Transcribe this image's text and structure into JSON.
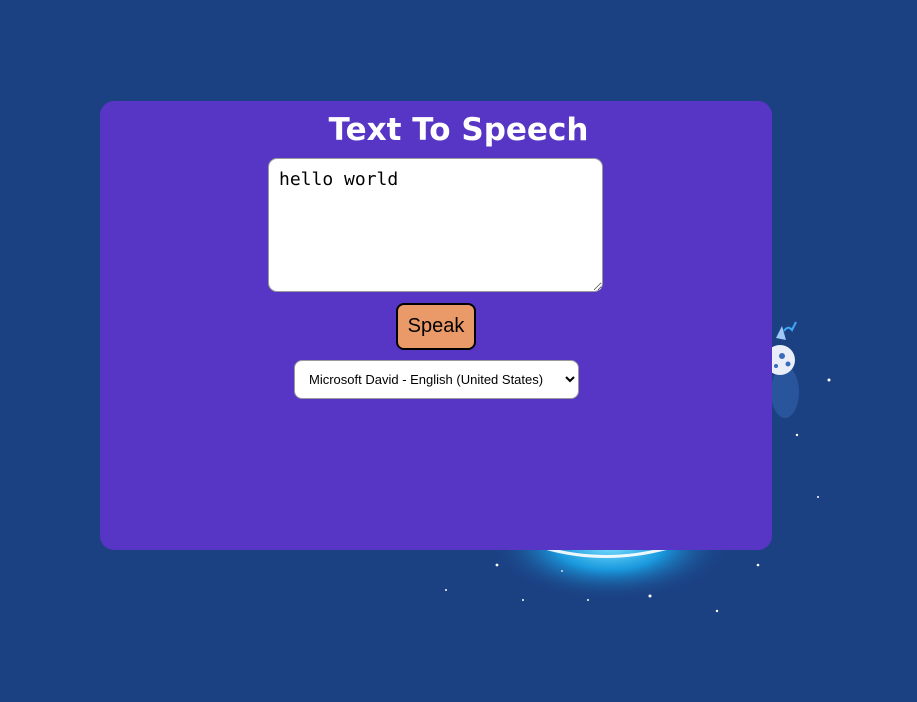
{
  "app": {
    "title": "Text To Speech"
  },
  "textarea": {
    "value": "hello world"
  },
  "speak_button": {
    "label": "Speak"
  },
  "voice_select": {
    "selected": "Microsoft David - English (United States)"
  },
  "colors": {
    "background": "#1b4183",
    "card": "#5735c5",
    "button": "#e99a68",
    "title_text": "#ffffff"
  },
  "icons": {
    "background_illustration": "space-robot-planet-illustration"
  }
}
